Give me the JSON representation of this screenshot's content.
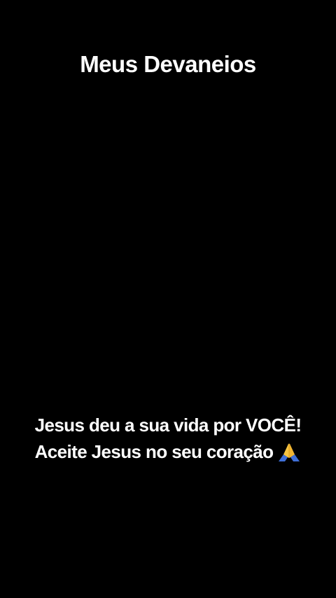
{
  "title": "Meus Devaneios",
  "message": {
    "line1": "Jesus deu a sua vida por VOCÊ!",
    "line2": "Aceite Jesus no seu coração"
  },
  "icons": {
    "emoji": "folded-hands-icon"
  },
  "colors": {
    "background": "#000000",
    "text": "#ffffff",
    "sleeve": "#3f6fd8",
    "hand": "#f6c441"
  }
}
